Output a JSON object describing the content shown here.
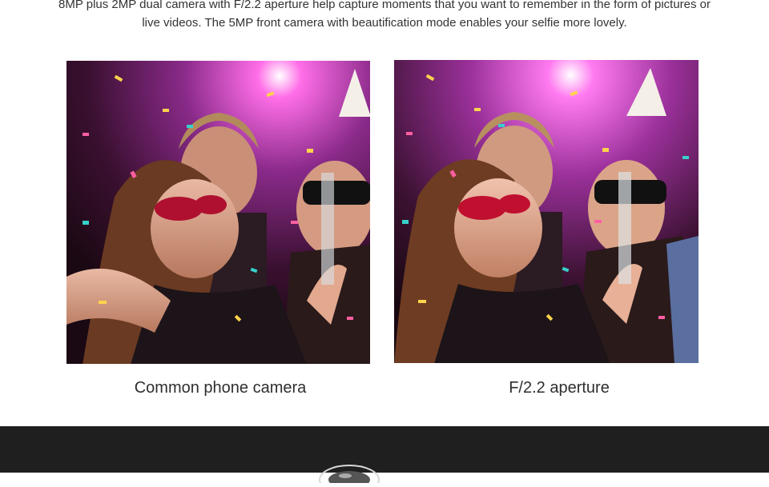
{
  "intro_text": "8MP plus 2MP dual camera with F/2.2 aperture help capture moments that you want to remember in the form of pictures or live videos. The 5MP front camera with beautification mode enables your selfie more lovely.",
  "comparison": {
    "left_caption": "Common phone camera",
    "right_caption": "F/2.2 aperture"
  },
  "colors": {
    "dark_band": "#1f1f1f",
    "spotlight": "#ff4fd8"
  }
}
